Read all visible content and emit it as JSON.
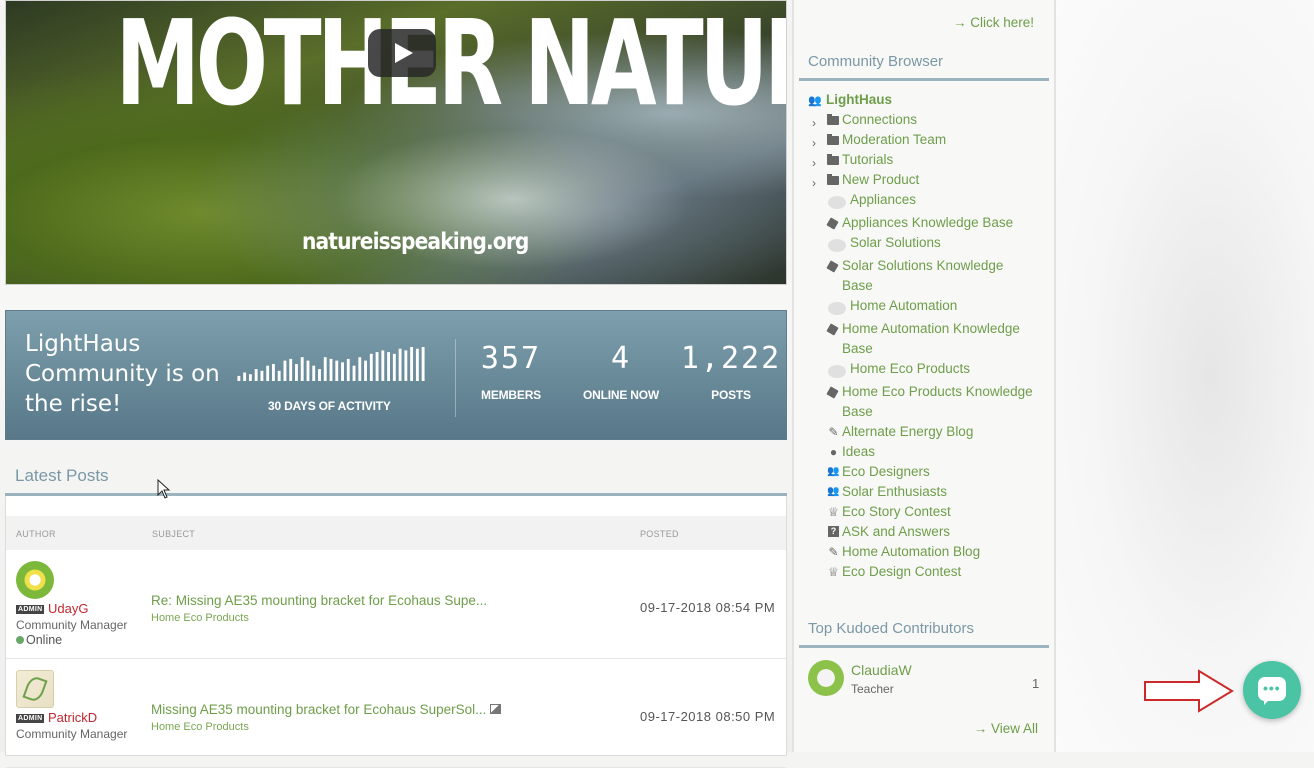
{
  "hero": {
    "title": "MOTHER NATURE",
    "url_text": "natureisspeaking.org"
  },
  "stats": {
    "headline": "LightHaus Community is on the rise!",
    "activity_label": "30 DAYS OF ACTIVITY",
    "activity_levels": [
      0.15,
      0.25,
      0.2,
      0.35,
      0.3,
      0.45,
      0.5,
      0.3,
      0.6,
      0.65,
      0.5,
      0.7,
      0.6,
      0.45,
      0.35,
      0.7,
      0.65,
      0.6,
      0.55,
      0.65,
      0.45,
      0.7,
      0.6,
      0.8,
      0.85,
      0.9,
      0.85,
      0.8,
      0.95,
      0.9,
      1.0,
      0.95,
      1.0
    ],
    "members": {
      "value": "357",
      "label": "MEMBERS"
    },
    "online": {
      "value": "4",
      "label": "ONLINE NOW"
    },
    "posts": {
      "value": "1,222",
      "label": "POSTS"
    }
  },
  "latest_posts": {
    "title": "Latest Posts",
    "columns": {
      "author": "AUTHOR",
      "subject": "SUBJECT",
      "posted": "POSTED"
    },
    "rows": [
      {
        "badge": "ADMIN",
        "author": "UdayG",
        "role": "Community Manager",
        "status": "Online",
        "subject": "Re: Missing AE35 mounting bracket for Ecohaus Supe...",
        "board": "Home Eco Products",
        "posted": "09-17-2018 08:54 PM"
      },
      {
        "badge": "ADMIN",
        "author": "PatrickD",
        "role": "Community Manager",
        "subject": "Missing AE35 mounting bracket for Ecohaus SuperSol...",
        "board": "Home Eco Products",
        "posted": "09-17-2018 08:50 PM"
      }
    ]
  },
  "sidebar": {
    "click_here": "→ Click here!",
    "browser_title": "Community Browser",
    "tree": [
      {
        "label": "LightHaus",
        "icon": "group-icon",
        "root": true
      },
      {
        "label": "Connections",
        "icon": "folder-icon",
        "expandable": true
      },
      {
        "label": "Moderation Team",
        "icon": "folder-icon",
        "expandable": true
      },
      {
        "label": "Tutorials",
        "icon": "folder-icon",
        "expandable": true
      },
      {
        "label": "New Product",
        "icon": "folder-icon",
        "expandable": true
      },
      {
        "label": "Appliances",
        "icon": "forum-bubble-icon"
      },
      {
        "label": "Appliances Knowledge Base",
        "icon": "knowledge-base-icon"
      },
      {
        "label": "Solar Solutions",
        "icon": "forum-bubble-icon"
      },
      {
        "label": "Solar Solutions Knowledge Base",
        "icon": "knowledge-base-icon"
      },
      {
        "label": "Home Automation",
        "icon": "forum-bubble-icon"
      },
      {
        "label": "Home Automation Knowledge Base",
        "icon": "knowledge-base-icon"
      },
      {
        "label": "Home Eco Products",
        "icon": "forum-bubble-icon"
      },
      {
        "label": "Home Eco Products Knowledge Base",
        "icon": "knowledge-base-icon"
      },
      {
        "label": "Alternate Energy Blog",
        "icon": "pencil-icon"
      },
      {
        "label": "Ideas",
        "icon": "lightbulb-icon"
      },
      {
        "label": "Eco Designers",
        "icon": "group-icon"
      },
      {
        "label": "Solar Enthusiasts",
        "icon": "group-icon"
      },
      {
        "label": "Eco Story Contest",
        "icon": "trophy-icon"
      },
      {
        "label": "ASK and Answers",
        "icon": "question-icon"
      },
      {
        "label": "Home Automation Blog",
        "icon": "pencil-icon"
      },
      {
        "label": "Eco Design Contest",
        "icon": "trophy-icon"
      }
    ],
    "kudos_title": "Top Kudoed Contributors",
    "kudos": {
      "name": "ClaudiaW",
      "role": "Teacher",
      "count": "1"
    },
    "view_all": "→ View All"
  },
  "chat": {
    "icon": "chat-bubble-icon",
    "accent": "#4bc4a6"
  },
  "annotation": {
    "arrow_color": "#cc2a2a"
  }
}
